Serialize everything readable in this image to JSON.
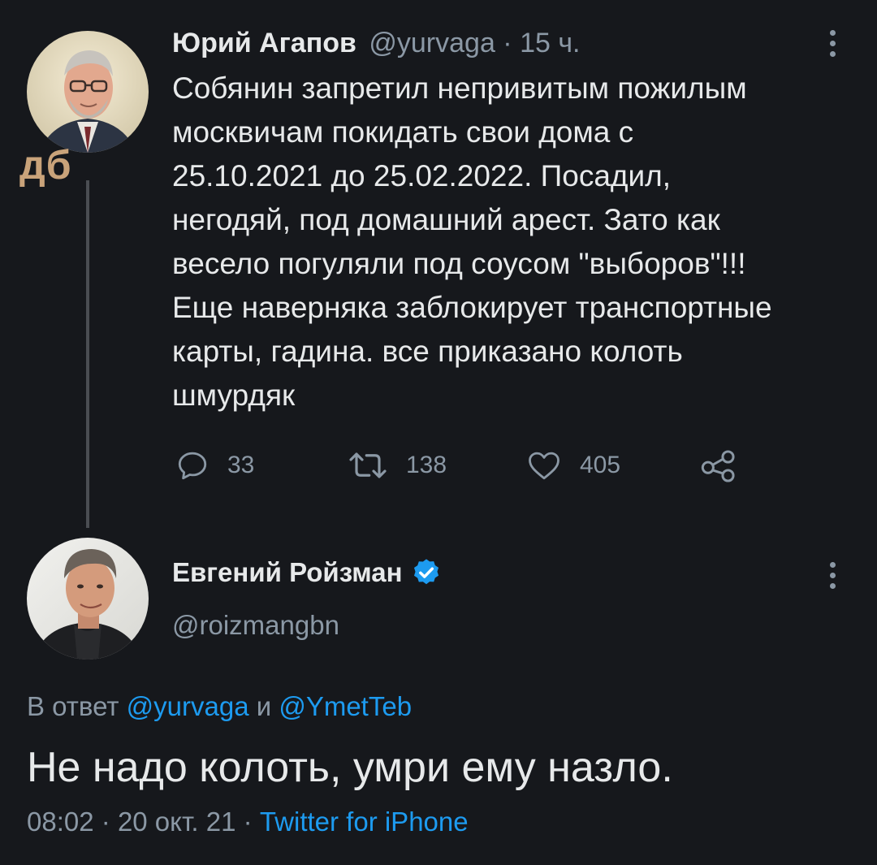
{
  "overlay_label": "дб",
  "tweet1": {
    "author_name": "Юрий Агапов",
    "meta": "@yurvaga · 15 ч.",
    "text": "Собянин запретил непривитым пожилым\nмосквичам покидать свои дома с\n25.10.2021 до 25.02.2022. Посадил,\nнегодяй, под домашний арест. Зато как\nвесело погуляли под соусом \"выборов\"!!!\nЕще наверняка заблокирует транспортные\nкарты, гадина. все приказано колоть\nшмурдяк",
    "replies": "33",
    "retweets": "138",
    "likes": "405"
  },
  "tweet2": {
    "author_name": "Евгений Ройзман",
    "handle": "@roizmangbn",
    "reply_prefix": "В ответ",
    "reply_user1": "@yurvaga",
    "reply_and": "и",
    "reply_user2": "@YmetTeb",
    "text": "Не надо колоть, умри ему назло.",
    "time": "08:02",
    "date": "20 окт. 21",
    "source": "Twitter for iPhone"
  },
  "colors": {
    "background": "#16181c",
    "text": "#e7e9ea",
    "muted": "#8b98a5",
    "link": "#1d9bf0",
    "verified": "#1d9bf0",
    "overlay_label": "#c9a37a"
  },
  "icons": {
    "reply": "speech-bubble-icon",
    "retweet": "retweet-icon",
    "like": "heart-icon",
    "share": "share-icon",
    "more": "more-vertical-icon",
    "verified": "verified-badge-icon"
  }
}
